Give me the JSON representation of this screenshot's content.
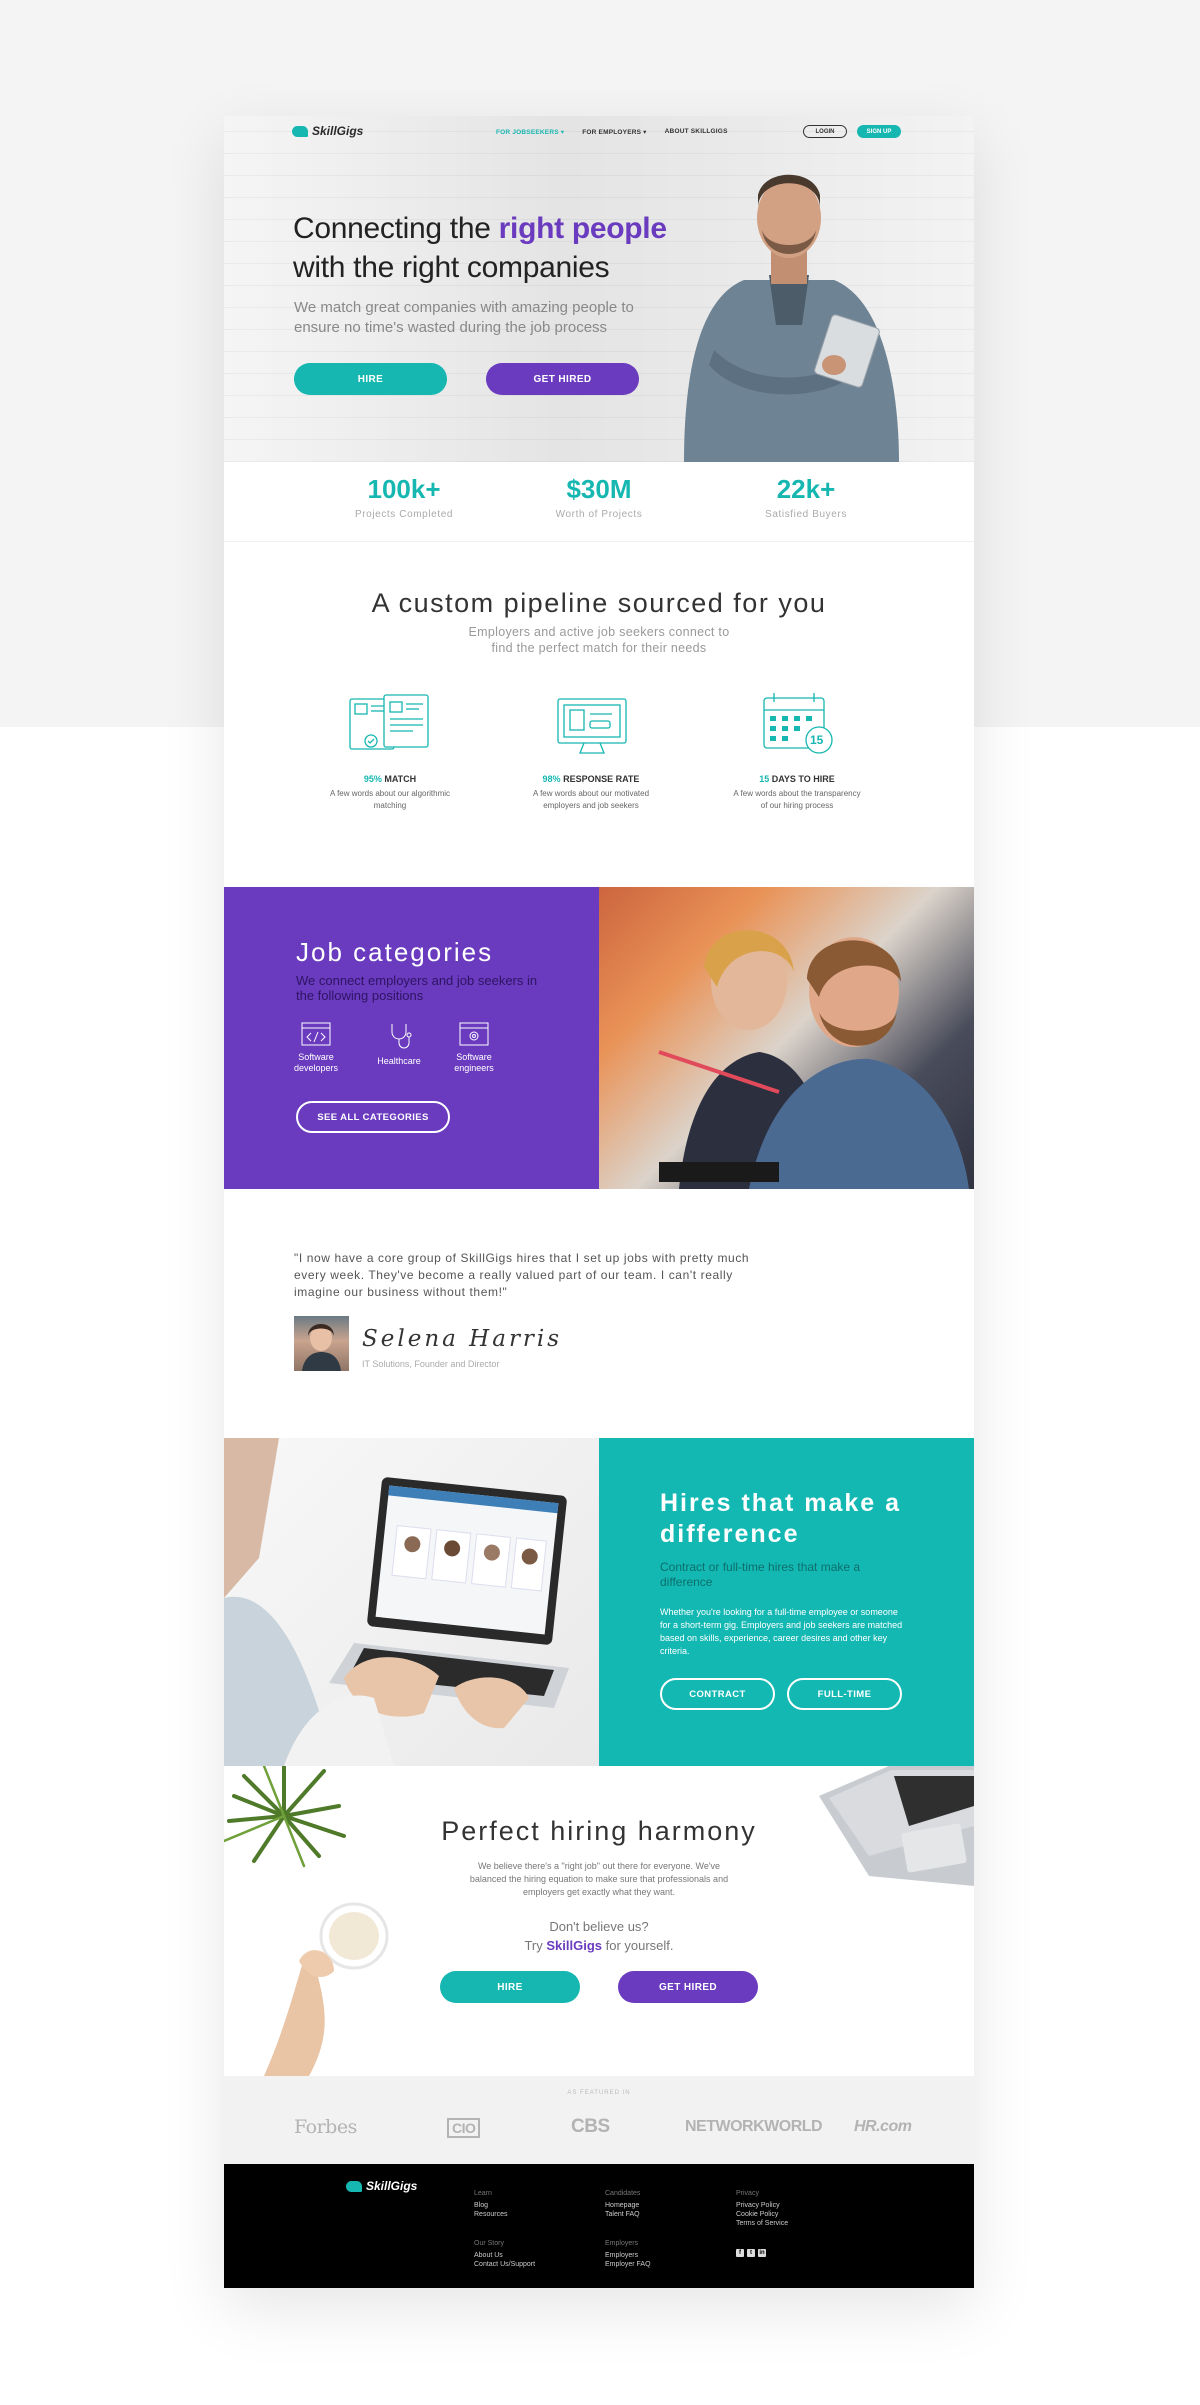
{
  "nav": {
    "brand": "SkillGigs",
    "links": [
      "FOR JOBSEEKERS ▾",
      "FOR EMPLOYERS ▾",
      "ABOUT SKILLGIGS"
    ],
    "login": "LOGIN",
    "signup": "SIGN UP"
  },
  "hero": {
    "title_pre": "Connecting the ",
    "title_highlight": "right people",
    "title_line2": "with the right companies",
    "subtitle": "We match great companies with amazing people to ensure no time's wasted during the job process",
    "hire": "HIRE",
    "get_hired": "GET HIRED"
  },
  "stats": [
    {
      "value": "100k+",
      "label": "Projects Completed"
    },
    {
      "value": "$30M",
      "label": "Worth of Projects"
    },
    {
      "value": "22k+",
      "label": "Satisfied Buyers"
    }
  ],
  "pipeline": {
    "title": "A custom pipeline sourced for you",
    "subtitle": "Employers and active job seekers connect to find the perfect match for their needs",
    "features": [
      {
        "num": "95%",
        "label": "MATCH",
        "desc": "A few words about our algorithmic matching"
      },
      {
        "num": "98%",
        "label": "RESPONSE RATE",
        "desc": "A few words about our motivated employers and job seekers"
      },
      {
        "num": "15",
        "label": "DAYS TO HIRE",
        "desc": "A few words about the transparency of our hiring process"
      }
    ],
    "calendar_badge": "15"
  },
  "jobs": {
    "title": "Job categories",
    "subtitle": "We connect employers and job seekers in the following positions",
    "categories": [
      "Software developers",
      "Healthcare",
      "Software engineers"
    ],
    "cta": "SEE ALL CATEGORIES"
  },
  "testimonial": {
    "quote": "\"I now have a core group of SkillGigs hires that I set up jobs with pretty much every week. They've become a really valued part of our team. I can't really imagine our business without them!\"",
    "name": "Selena Harris",
    "role": "IT Solutions, Founder and Director"
  },
  "hires": {
    "title": "Hires that make a difference",
    "subtitle": "Contract or full-time hires that make a difference",
    "desc": "Whether you're looking for a full-time employee or someone for a short-term gig. Employers and job seekers are matched based on skills, experience, career desires and other key criteria.",
    "contract": "CONTRACT",
    "fulltime": "FULL-TIME"
  },
  "harmony": {
    "title": "Perfect hiring harmony",
    "desc": "We believe there's a \"right job\" out there for everyone. We've balanced the hiring equation to make sure that professionals and employers get exactly what they want.",
    "q1": "Don't believe us?",
    "q2_pre": "Try ",
    "q2_brand": "SkillGigs",
    "q2_post": " for yourself.",
    "hire": "HIRE",
    "get_hired": "GET HIRED"
  },
  "featured": {
    "caption": "AS FEATURED IN",
    "logos": [
      "Forbes",
      "CIO",
      "CBS",
      "NETWORKWORLD",
      "HR.com"
    ]
  },
  "footer": {
    "brand": "SkillGigs",
    "cols": [
      {
        "head": "Learn",
        "items": [
          "Blog",
          "Resources"
        ]
      },
      {
        "head": "Candidates",
        "items": [
          "Homepage",
          "Talent FAQ"
        ]
      },
      {
        "head": "Privacy",
        "items": [
          "Privacy Policy",
          "Cookie Policy",
          "Terms of Service"
        ]
      },
      {
        "head": "Our Story",
        "items": [
          "About Us",
          "Contact Us/Support"
        ]
      },
      {
        "head": "Employers",
        "items": [
          "Employers",
          "Employer FAQ"
        ]
      }
    ],
    "social": [
      "facebook-icon",
      "twitter-icon",
      "linkedin-icon"
    ]
  },
  "colors": {
    "teal": "#16b7b1",
    "purple": "#6a3bbe",
    "footer": "#000000"
  }
}
